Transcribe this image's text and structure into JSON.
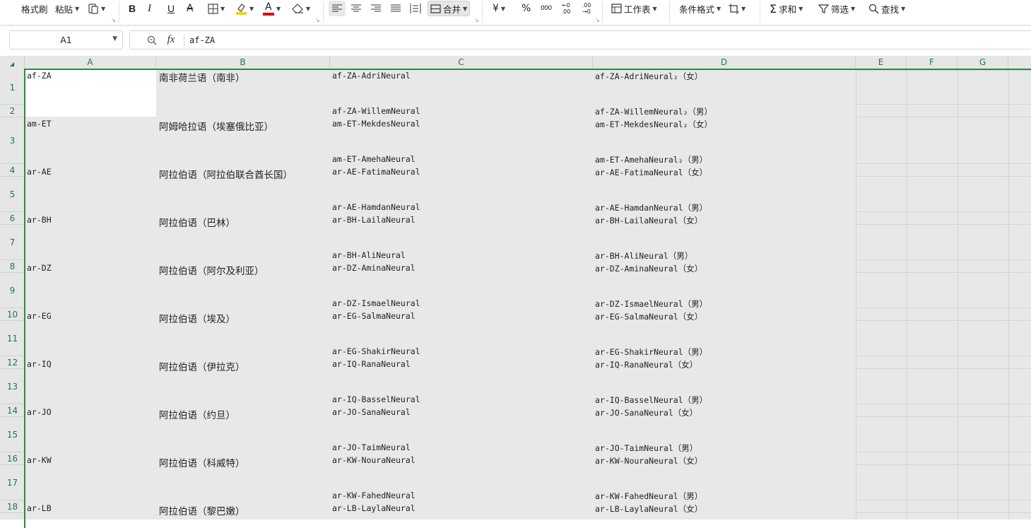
{
  "toolbar": {
    "format_painter": "格式刷",
    "paste": "粘贴",
    "merge": "合并",
    "currency": "¥",
    "percent": "%",
    "thousands": "000",
    "decimal_inc": "←0 .00",
    "decimal_dec": ".00 →0",
    "worksheet": "工作表",
    "conditional_format": "条件格式",
    "sum": "求和",
    "filter": "筛选",
    "find": "查找",
    "bold": "B",
    "italic": "I",
    "underline": "U",
    "strike": "A",
    "font_color": "A",
    "highlight_color": "#f5d400",
    "font_color_bar": "#e00000"
  },
  "formula_bar": {
    "cell_ref": "A1",
    "fx_label": "fx",
    "value": "af-ZA"
  },
  "columns": [
    "A",
    "B",
    "C",
    "D",
    "E",
    "F",
    "G"
  ],
  "rows": [
    "1",
    "2",
    "3",
    "4",
    "5",
    "6",
    "7",
    "8",
    "9",
    "10",
    "11",
    "12",
    "13",
    "14",
    "15",
    "16",
    "17",
    "18"
  ],
  "entries": [
    {
      "code": "af-ZA",
      "lang": "南非荷兰语（南非）",
      "voice_f": "af-ZA-AdriNeural",
      "desc_f": "af-ZA-AdriNeural₂（女）",
      "voice_m": "af-ZA-WillemNeural",
      "desc_m": "af-ZA-WillemNeural₂（男）"
    },
    {
      "code": "am-ET",
      "lang": "阿姆哈拉语（埃塞俄比亚）",
      "voice_f": "am-ET-MekdesNeural",
      "desc_f": "am-ET-MekdesNeural₂（女）",
      "voice_m": "am-ET-AmehaNeural",
      "desc_m": "am-ET-AmehaNeural₂（男）"
    },
    {
      "code": "ar-AE",
      "lang": "阿拉伯语（阿拉伯联合酋长国）",
      "voice_f": "ar-AE-FatimaNeural",
      "desc_f": "ar-AE-FatimaNeural（女）",
      "voice_m": "ar-AE-HamdanNeural",
      "desc_m": "ar-AE-HamdanNeural（男）"
    },
    {
      "code": "ar-BH",
      "lang": "阿拉伯语（巴林）",
      "voice_f": "ar-BH-LailaNeural",
      "desc_f": "ar-BH-LailaNeural（女）",
      "voice_m": "ar-BH-AliNeural",
      "desc_m": "ar-BH-AliNeural（男）"
    },
    {
      "code": "ar-DZ",
      "lang": "阿拉伯语（阿尔及利亚）",
      "voice_f": "ar-DZ-AminaNeural",
      "desc_f": "ar-DZ-AminaNeural（女）",
      "voice_m": "ar-DZ-IsmaelNeural",
      "desc_m": "ar-DZ-IsmaelNeural（男）"
    },
    {
      "code": "ar-EG",
      "lang": "阿拉伯语（埃及）",
      "voice_f": "ar-EG-SalmaNeural",
      "desc_f": "ar-EG-SalmaNeural（女）",
      "voice_m": "ar-EG-ShakirNeural",
      "desc_m": "ar-EG-ShakirNeural（男）"
    },
    {
      "code": "ar-IQ",
      "lang": "阿拉伯语（伊拉克）",
      "voice_f": "ar-IQ-RanaNeural",
      "desc_f": "ar-IQ-RanaNeural（女）",
      "voice_m": "ar-IQ-BasselNeural",
      "desc_m": "ar-IQ-BasselNeural（男）"
    },
    {
      "code": "ar-JO",
      "lang": "阿拉伯语（约旦）",
      "voice_f": "ar-JO-SanaNeural",
      "desc_f": "ar-JO-SanaNeural（女）",
      "voice_m": "ar-JO-TaimNeural",
      "desc_m": "ar-JO-TaimNeural（男）"
    },
    {
      "code": "ar-KW",
      "lang": "阿拉伯语（科威特）",
      "voice_f": "ar-KW-NouraNeural",
      "desc_f": "ar-KW-NouraNeural（女）",
      "voice_m": "ar-KW-FahedNeural",
      "desc_m": "ar-KW-FahedNeural（男）"
    },
    {
      "code": "ar-LB",
      "lang": "阿拉伯语（黎巴嫩）",
      "voice_f": "ar-LB-LaylaNeural",
      "desc_f": "ar-LB-LaylaNeural（女）",
      "voice_m": "",
      "desc_m": ""
    }
  ]
}
